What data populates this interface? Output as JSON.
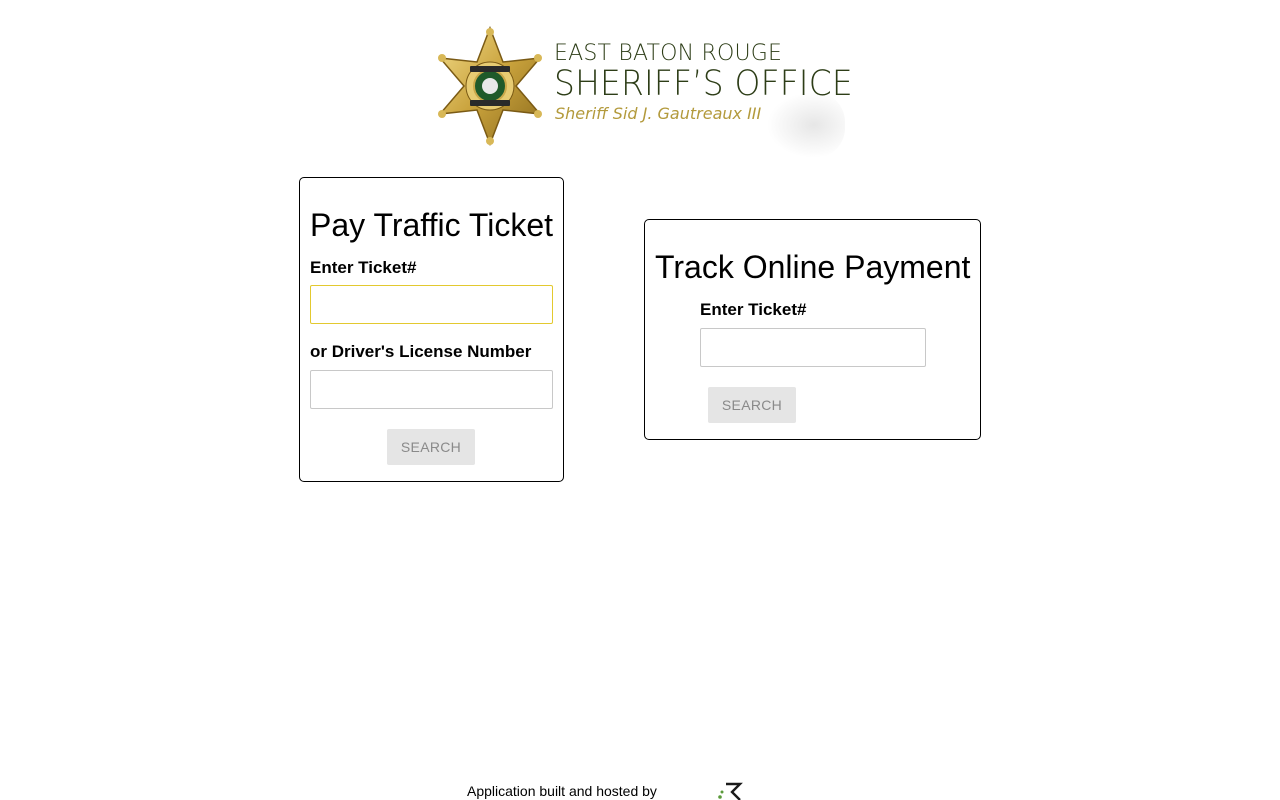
{
  "header": {
    "logo_line1": "EAST BATON ROUGE",
    "logo_line2": "SHERIFF’S OFFICE",
    "logo_line3": "Sheriff Sid J. Gautreaux III",
    "badge_icon": "sheriff-star-badge-icon",
    "colors": {
      "green": "#2d3d17",
      "gold": "#b39a3c"
    }
  },
  "pay_card": {
    "title": "Pay Traffic Ticket",
    "ticket_label": "Enter Ticket#",
    "ticket_value": "",
    "dl_label": "or Driver's License Number",
    "dl_value": "",
    "search_label": "SEARCH"
  },
  "track_card": {
    "title": "Track Online Payment",
    "ticket_label": "Enter Ticket#",
    "ticket_value": "",
    "search_label": "SEARCH"
  },
  "footer": {
    "text": "Application built and hosted by",
    "logo_icon": "provider-logo-icon"
  }
}
